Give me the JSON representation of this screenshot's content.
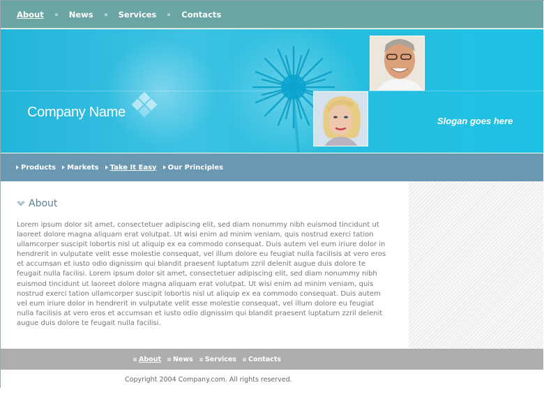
{
  "top_nav": {
    "items": [
      {
        "label": "About",
        "active": true
      },
      {
        "label": "News",
        "active": false
      },
      {
        "label": "Services",
        "active": false
      },
      {
        "label": "Contacts",
        "active": false
      }
    ]
  },
  "banner": {
    "company_name": "Company Name",
    "slogan": "Slogan goes here"
  },
  "sub_nav": {
    "items": [
      {
        "label": "Products",
        "active": false
      },
      {
        "label": "Markets",
        "active": false
      },
      {
        "label": "Take It Easy",
        "active": true
      },
      {
        "label": "Our Principles",
        "active": false
      }
    ]
  },
  "main": {
    "heading": "About",
    "body": "Lorem ipsum dolor sit amet, consectetuer adipiscing elit, sed diam nonummy nibh euismod tincidunt ut laoreet dolore magna aliquam erat volutpat. Ut wisi enim ad minim veniam, quis nostrud exerci tation ullamcorper suscipit lobortis nisl ut aliquip ex ea commodo consequat. Duis autem vel eum iriure dolor in hendrerit in vulputate velit esse molestie consequat, vel illum dolore eu feugiat nulla facilisis at vero eros et accumsan et iusto odio dignissim qui blandit praesent luptatum zzril delenit augue duis dolore te feugait nulla facilisi. Lorem ipsum dolor sit amet, consectetuer adipiscing elit, sed diam nonummy nibh euismod tincidunt ut laoreet dolore magna aliquam erat volutpat. Ut wisi enim ad minim veniam, quis nostrud exerci tation ullamcorper suscipit lobortis nisl ut aliquip ex ea commodo consequat. Duis autem vel eum iriure dolor in hendrerit in vulputate velit esse molestie consequat, vel illum dolore eu feugiat nulla facilisis at vero eros et accumsan et iusto odio dignissim qui blandit praesent luptatum zzril delenit augue duis dolore te feugait nulla facilisi."
  },
  "footer": {
    "items": [
      {
        "label": "About",
        "active": true
      },
      {
        "label": "News",
        "active": false
      },
      {
        "label": "Services",
        "active": false
      },
      {
        "label": "Contacts",
        "active": false
      }
    ],
    "copyright": "Copyright 2004 Company.com. All rights reserved."
  },
  "colors": {
    "top_nav_bg": "#6aa5a3",
    "banner_bg": "#27bddf",
    "sub_nav_bg": "#6a98b2",
    "footer_bg": "#adadad",
    "heading_text": "#5c7f8f",
    "body_text": "#777777"
  },
  "icons": [
    "logo-diamond-icon",
    "flower-graphic",
    "triangle-bullet-icon",
    "square-bullet-icon",
    "heading-arrow-icon"
  ]
}
